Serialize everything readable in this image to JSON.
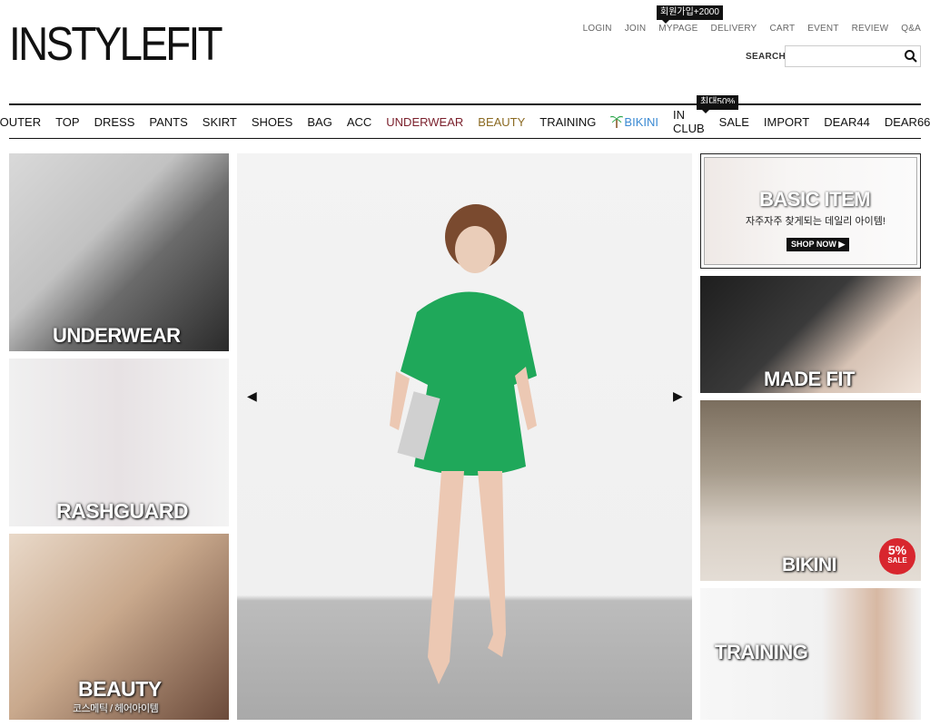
{
  "brand": {
    "logo": "INSTYLEFIT"
  },
  "top_links": [
    "LOGIN",
    "JOIN",
    "MYPAGE",
    "DELIVERY",
    "CART",
    "EVENT",
    "REVIEW",
    "Q&A"
  ],
  "tooltips": {
    "join": "회원가입+2000",
    "sale": "최대50%"
  },
  "search": {
    "label": "SEARCH",
    "placeholder": ""
  },
  "nav": [
    "OUTER",
    "TOP",
    "DRESS",
    "PANTS",
    "SKIRT",
    "SHOES",
    "BAG",
    "ACC",
    "UNDERWEAR",
    "BEAUTY",
    "TRAINING",
    "BIKINI",
    "IN CLUB",
    "SALE",
    "IMPORT",
    "DEAR44",
    "DEAR66"
  ],
  "tiles": {
    "underwear": "UNDERWEAR",
    "rashguard": "RASHGUARD",
    "beauty": "BEAUTY",
    "beauty_sub": "코스메틱 / 헤어아이템",
    "basic_title": "BASIC ITEM",
    "basic_sub": "자주자주 찾게되는 데일리 아이템!",
    "shop_now": "SHOP NOW ▶",
    "made_fit": "MADE FIT",
    "bikini": "BIKINI",
    "bikini_badge": "5%",
    "bikini_badge_sub": "SALE",
    "training": "TRAINING"
  },
  "colors": {
    "underwear": "#7a1f2b",
    "beauty": "#8b6a22",
    "bikini": "#3b8ad3",
    "sale_badge": "#d8262e"
  }
}
